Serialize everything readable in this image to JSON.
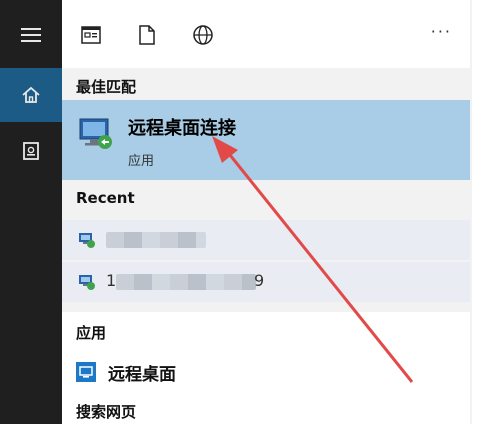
{
  "sidebar": {
    "items": [
      {
        "icon": "hamburger-menu-icon"
      },
      {
        "icon": "home-icon",
        "active": true
      },
      {
        "icon": "notebook-icon"
      }
    ]
  },
  "toolbar": {
    "icons": [
      "apps-filter-icon",
      "documents-filter-icon",
      "web-filter-icon"
    ],
    "more_label": "···"
  },
  "sections": {
    "best_match": {
      "title": "最佳匹配",
      "item": {
        "title": "远程桌面连接",
        "subtitle": "应用",
        "icon": "remote-desktop-icon"
      }
    },
    "recent": {
      "title": "Recent",
      "items": [
        {
          "text_prefix": "",
          "text_suffix": "",
          "icon": "remote-desktop-small-icon"
        },
        {
          "text_prefix": "1",
          "text_suffix": "9",
          "icon": "remote-desktop-small-icon"
        }
      ]
    },
    "apps": {
      "title": "应用",
      "item": {
        "label": "远程桌面",
        "icon": "remote-desktop-app-icon"
      }
    },
    "web": {
      "title": "搜索网页"
    }
  },
  "colors": {
    "sidebar_bg": "#1f1f1f",
    "sidebar_active": "#1c5b86",
    "best_match_bg": "#a9cde6",
    "arrow": "#e24a4a"
  }
}
